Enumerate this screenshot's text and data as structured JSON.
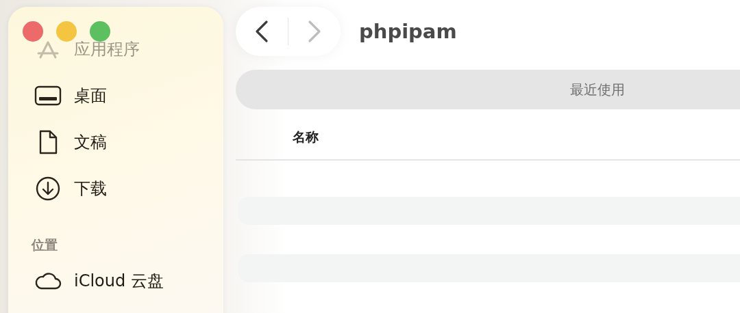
{
  "sidebar": {
    "sections": [
      {
        "items": [
          {
            "label": "应用程序",
            "kind": "apps",
            "obscured": true
          },
          {
            "label": "桌面",
            "kind": "desktop",
            "obscured": false
          },
          {
            "label": "文稿",
            "kind": "document",
            "obscured": false
          },
          {
            "label": "下载",
            "kind": "download",
            "obscured": false
          }
        ]
      },
      {
        "title": "位置",
        "items": [
          {
            "label": "iCloud 云盘",
            "kind": "cloud",
            "obscured": false
          }
        ]
      }
    ]
  },
  "toolbar": {
    "title": "phpipam",
    "back_enabled": true,
    "forward_enabled": false
  },
  "tab_bar": {
    "label": "最近使用"
  },
  "table": {
    "columns": [
      "名称"
    ]
  }
}
